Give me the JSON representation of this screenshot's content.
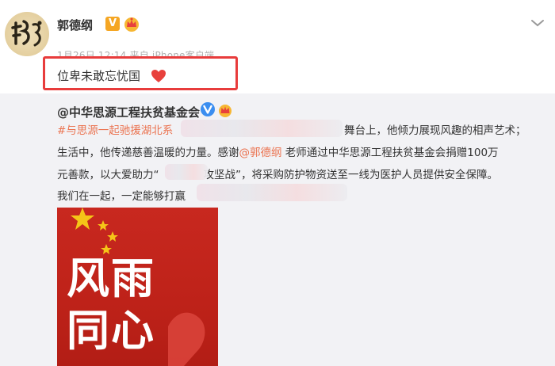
{
  "post": {
    "author": "郭德纲",
    "verified_mark": "V",
    "meta": "1月26日 12:14 来自 iPhone客户端",
    "text": "位卑未敢忘忧国"
  },
  "repost": {
    "author": "@中华思源工程扶贫基金会",
    "line1": {
      "hashtag": "#与思源一起驰援湖北系",
      "rest": "舞台上，他倾力展现风趣的相声艺术；"
    },
    "line2": {
      "a": "生活中，他传递慈善温暖的力量。感谢",
      "mention": "@郭德纲",
      "b": " 老师通过中华思源工程扶贫基金会捐赠100万"
    },
    "line3": {
      "a": "元善款，以大爱助力“",
      "b": "攻坚战”，将采购防护物资送至一线为医护人员提供安全保障。"
    },
    "line4": "我们在一起，一定能够打赢",
    "poster": {
      "line1": "风雨",
      "line2": "同心"
    }
  },
  "colors": {
    "highlight": "#e83c3c",
    "link": "#eb7350",
    "badge": "#f5a623",
    "poster_red": "#c8281f",
    "repost_bg": "#f2f2f5"
  },
  "icons": {
    "verified": "orange-v-icon",
    "vip": "crown-icon",
    "more": "chevron-down-icon",
    "heart": "heart-icon",
    "repost_verified": "blue-v-icon"
  }
}
